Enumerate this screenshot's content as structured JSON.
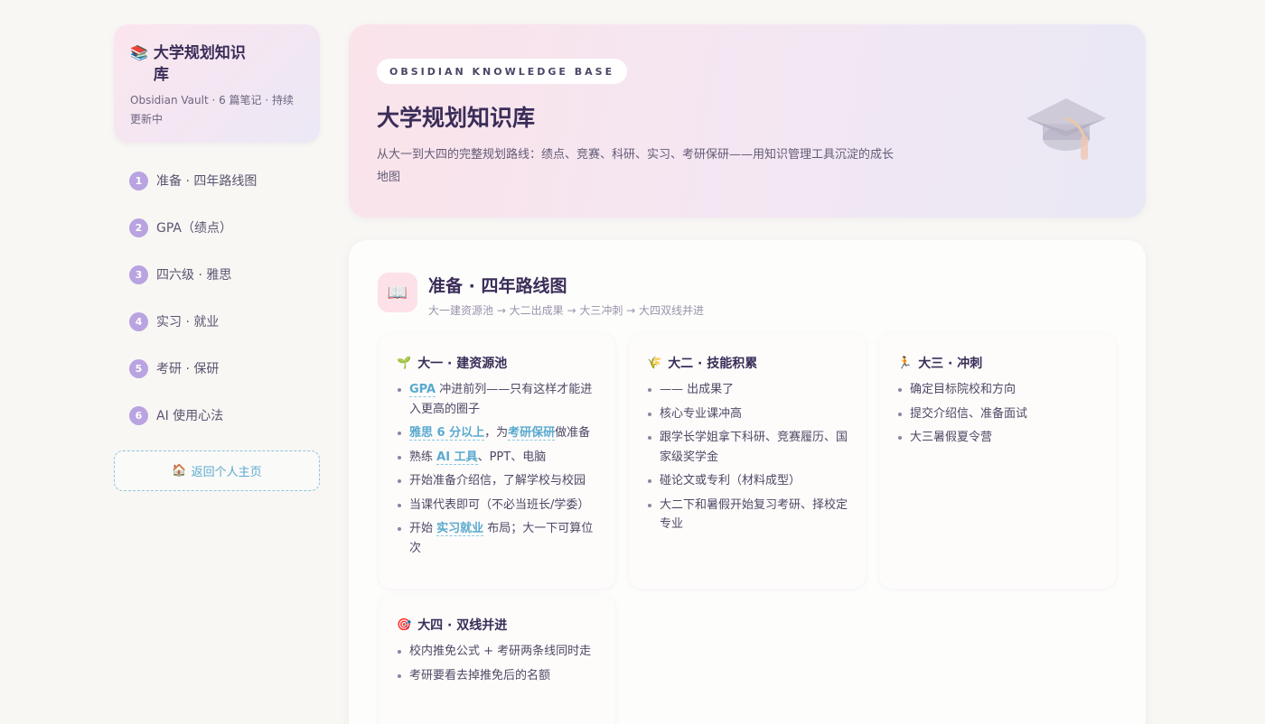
{
  "sidebar": {
    "brand_emoji": "📚",
    "brand_title": "大学规划知识库",
    "brand_sub": "Obsidian Vault · 6 篇笔记 · 持续更新中",
    "items": [
      {
        "num": "1",
        "label": "准备 · 四年路线图"
      },
      {
        "num": "2",
        "label": "GPA（绩点）"
      },
      {
        "num": "3",
        "label": "四六级 · 雅思"
      },
      {
        "num": "4",
        "label": "实习 · 就业"
      },
      {
        "num": "5",
        "label": "考研 · 保研"
      },
      {
        "num": "6",
        "label": "AI 使用心法"
      }
    ],
    "home_icon": "🏠",
    "home_label": "返回个人主页"
  },
  "hero": {
    "tag": "OBSIDIAN KNOWLEDGE BASE",
    "title": "大学规划知识库",
    "desc": "从大一到大四的完整规划路线：绩点、竞赛、科研、实习、考研保研——用知识管理工具沉淀的成长地图",
    "icon": "graduation-cap-icon"
  },
  "section": {
    "icon": "📖",
    "title": "准备 · 四年路线图",
    "subtitle": "大一建资源池 → 大二出成果 → 大三冲刺 → 大四双线并进"
  },
  "years": {
    "y1": {
      "emoji": "🌱",
      "title": "大一 · 建资源池",
      "i1_hl": "GPA",
      "i1_rest": " 冲进前列——只有这样才能进入更高的圈子",
      "i2_hl": "雅思 6 分以上",
      "i2_mid": "，为",
      "i2_hl2": "考研保研",
      "i2_end": "做准备",
      "i3_pre": "熟练 ",
      "i3_hl": "AI 工具",
      "i3_end": "、PPT、电脑",
      "i4": "开始准备介绍信，了解学校与校园",
      "i5": "当课代表即可（不必当班长/学委）",
      "i6_pre": "开始 ",
      "i6_hl": "实习就业",
      "i6_end": " 布局；大一下可算位次"
    },
    "y2": {
      "emoji": "🌾",
      "title": "大二 · 技能积累",
      "items": [
        "—— 出成果了",
        "核心专业课冲高",
        "跟学长学姐拿下科研、竞赛履历、国家级奖学金",
        "碰论文或专利（材料成型）",
        "大二下和暑假开始复习考研、择校定专业"
      ]
    },
    "y3": {
      "emoji": "🏃",
      "title": "大三 · 冲刺",
      "items": [
        "确定目标院校和方向",
        "提交介绍信、准备面试",
        "大三暑假夏令营"
      ]
    },
    "y4": {
      "emoji": "🎯",
      "title": "大四 · 双线并进",
      "items": [
        "校内推免公式 + 考研两条线同时走",
        "考研要看去掉推免后的名额"
      ]
    }
  }
}
